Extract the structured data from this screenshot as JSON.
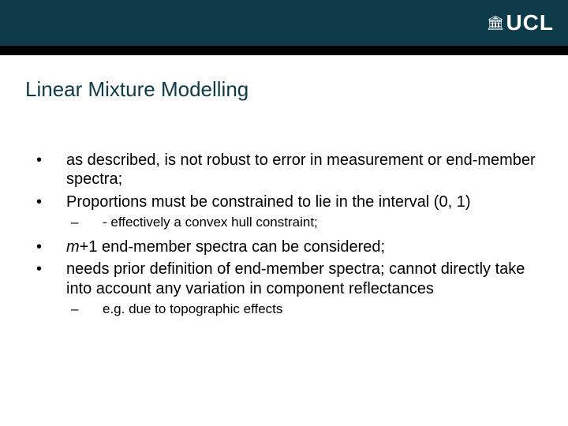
{
  "header": {
    "logo_symbol": "🏛",
    "logo_text": "UCL"
  },
  "title": "Linear Mixture Modelling",
  "bullets": [
    {
      "text": "as described, is not robust to error in measurement or end-member spectra;",
      "sub": null
    },
    {
      "text": "Proportions must be constrained to lie in the interval (0, 1)",
      "sub": "- effectively a convex hull constraint;"
    },
    {
      "text_prefix_italic": "m",
      "text_rest": "+1 end-member spectra can be considered;",
      "sub": null
    },
    {
      "text": "needs prior definition of end-member spectra; cannot directly take into account any variation in component reflectances",
      "sub": "e.g. due to topographic effects"
    }
  ]
}
